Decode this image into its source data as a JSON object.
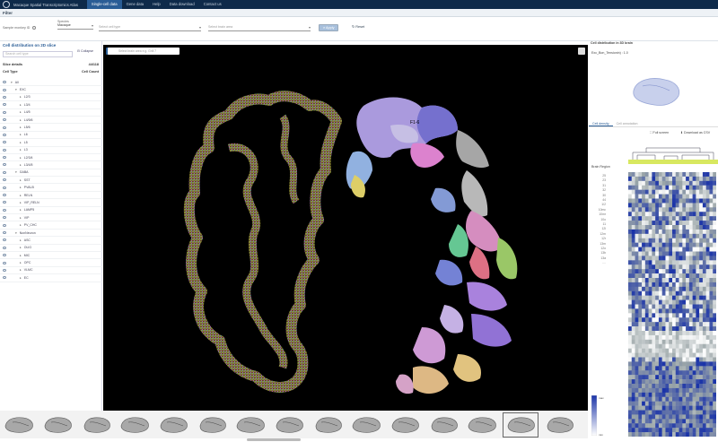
{
  "nav": {
    "title": "Macaque Spatial Transcriptomics Atlas",
    "items": [
      "Single-cell data",
      "Gene data",
      "Help",
      "Data download",
      "Contact us"
    ],
    "active_index": 0
  },
  "filter": {
    "header": "Filter",
    "sample_label": "Sample monkey ID",
    "species_label": "Species",
    "species_value": "Macaque",
    "cell_type_placeholder": "Select cell type",
    "brain_area_placeholder": "Select brain area",
    "apply_label": "Apply",
    "reset_label": "Reset"
  },
  "left_panel": {
    "title": "Cell distribution on 2D slice",
    "search_placeholder": "Search cell type",
    "collapse_label": "Collapse",
    "slice_details_label": "Slice details",
    "slice_details_value": "44/118",
    "col_cell_type": "Cell Type",
    "col_cell_count": "Cell Count",
    "tree": [
      {
        "label": "All",
        "level": 0
      },
      {
        "label": "EXC",
        "level": 1
      },
      {
        "label": "L2/3",
        "level": 2
      },
      {
        "label": "L3/4",
        "level": 2
      },
      {
        "label": "L4/5",
        "level": 2
      },
      {
        "label": "L4/5/6",
        "level": 2
      },
      {
        "label": "L5/6",
        "level": 2
      },
      {
        "label": "L6",
        "level": 2
      },
      {
        "label": "L5",
        "level": 2
      },
      {
        "label": "L3",
        "level": 2
      },
      {
        "label": "L2/3/4",
        "level": 2
      },
      {
        "label": "L3/4/5",
        "level": 2
      },
      {
        "label": "GABA",
        "level": 1
      },
      {
        "label": "SST",
        "level": 2
      },
      {
        "label": "PVALB",
        "level": 2
      },
      {
        "label": "RELN",
        "level": 2
      },
      {
        "label": "VIP_RELN",
        "level": 2
      },
      {
        "label": "LAMP5",
        "level": 2
      },
      {
        "label": "VIP",
        "level": 2
      },
      {
        "label": "PV_CHC",
        "level": 2
      },
      {
        "label": "NonNeuron",
        "level": 1
      },
      {
        "label": "ASC",
        "level": 2
      },
      {
        "label": "OLIG",
        "level": 2
      },
      {
        "label": "MIC",
        "level": 2
      },
      {
        "label": "OPC",
        "level": 2
      },
      {
        "label": "VLMC",
        "level": 2
      },
      {
        "label": "EC",
        "level": 2
      }
    ]
  },
  "canvas": {
    "search_placeholder": "Select brain area e.g. Grill 7",
    "region_label": "F1-6"
  },
  "right_panel": {
    "title": "Cell distribution in 3D brain",
    "subtitle": "Exc_Bon_Tensionin) : 1.0",
    "tab_cell_density": "Cell density",
    "tab_cell_annotation": "Cell annotation",
    "full_screen_label": "Full screen",
    "download_label": "Download as CSV",
    "brain_region_label": "Brain Region",
    "region_labels": [
      "25",
      "23",
      "31",
      "32",
      "30",
      "44",
      "1/2",
      "10mc",
      "10mr",
      "10o",
      "11",
      "12l",
      "12m",
      "12r",
      "13m",
      "12o",
      "13b",
      "13a",
      "...."
    ],
    "scale_max": "max",
    "scale_min": "min"
  },
  "colors": {
    "nav_bg": "#0e2a4a",
    "accent": "#2a5d96",
    "heatmap_low": "#ffffff",
    "heatmap_high": "#1a33a8"
  }
}
